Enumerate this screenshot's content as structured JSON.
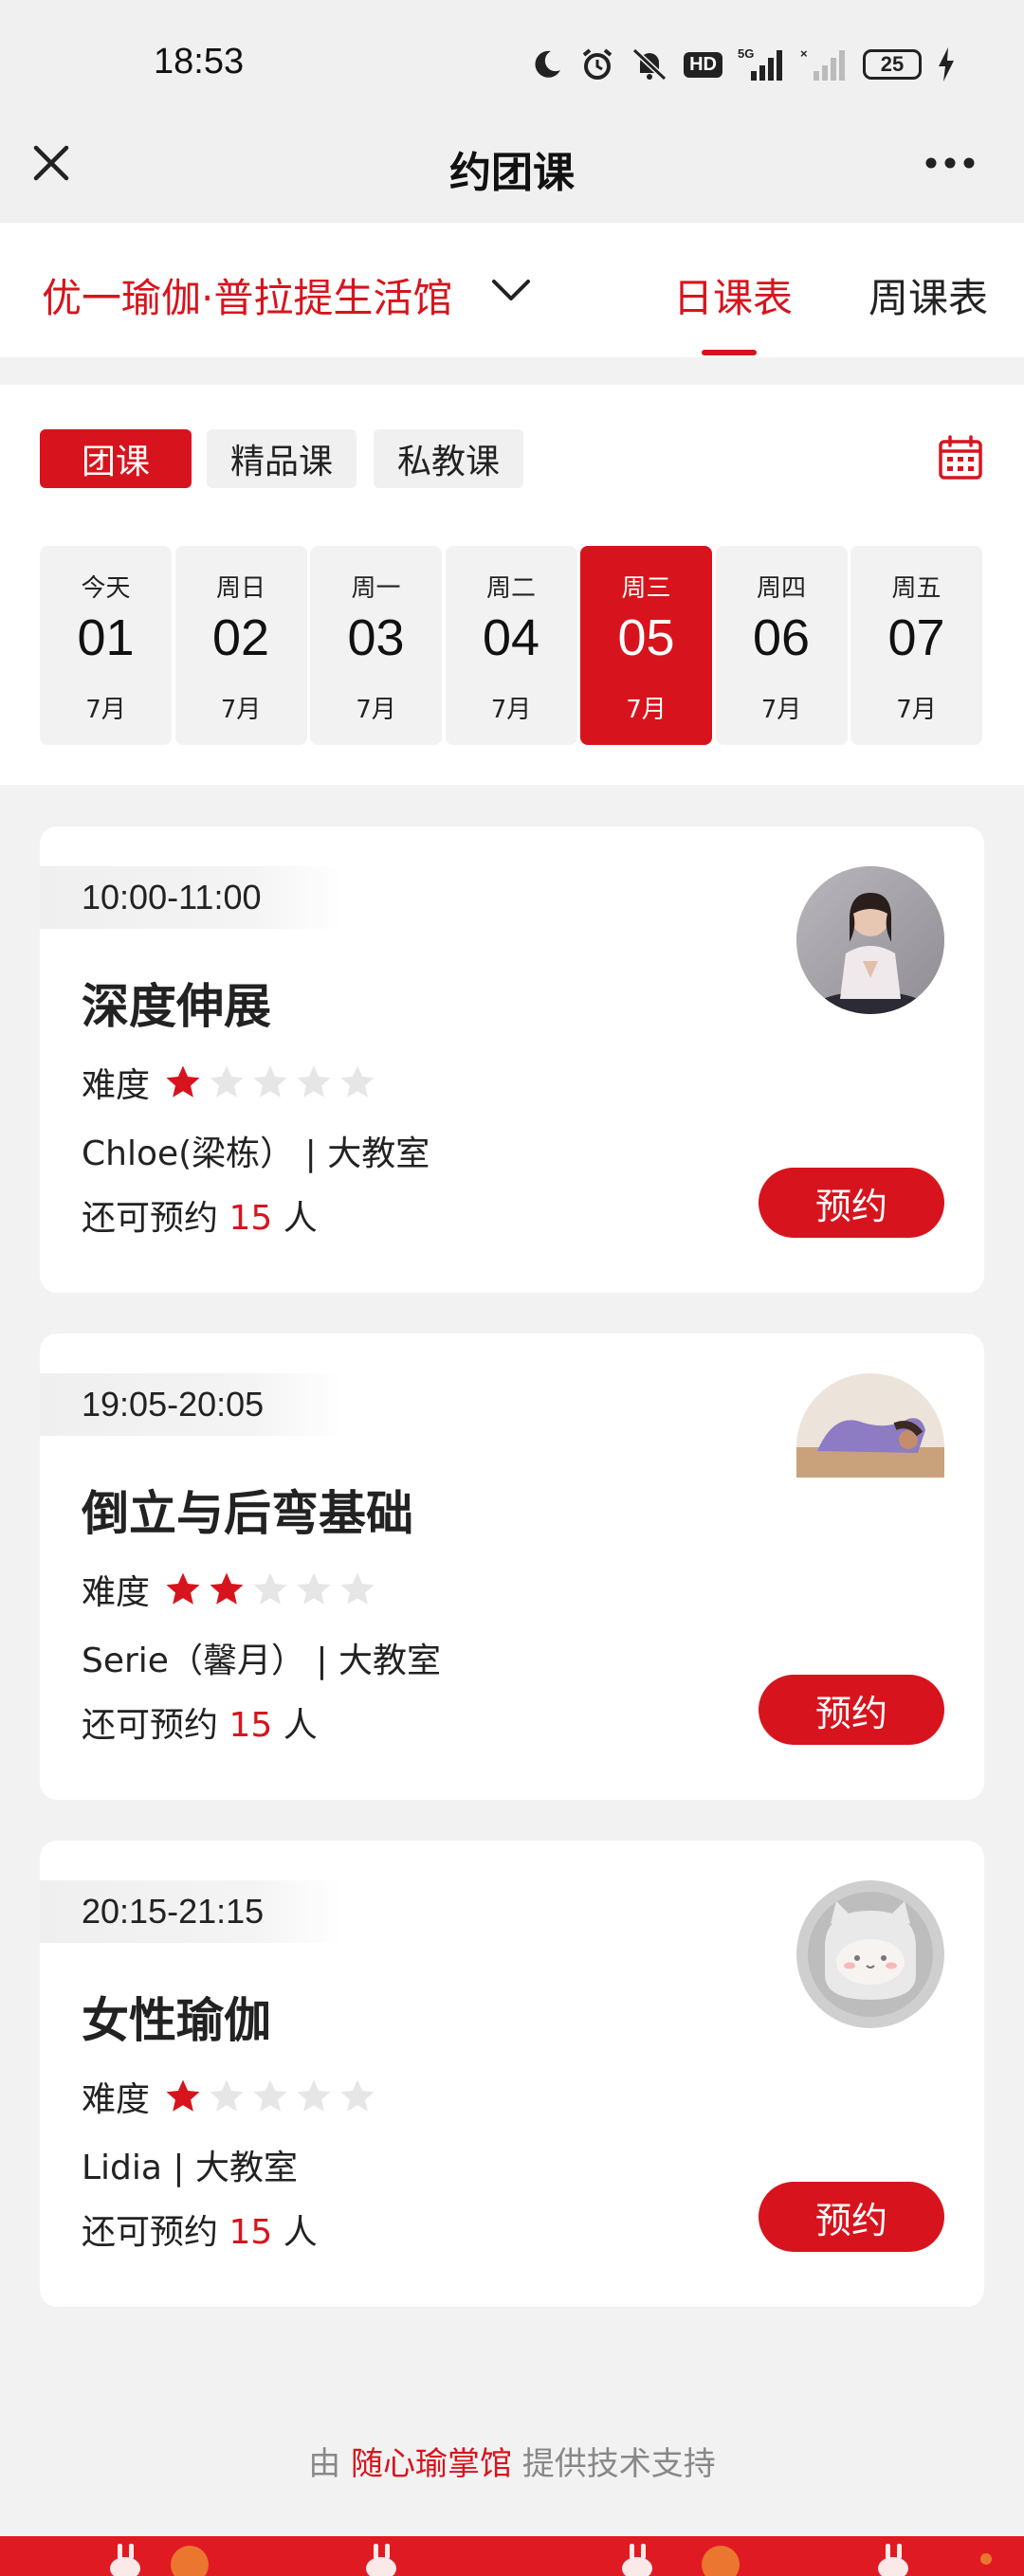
{
  "status_bar": {
    "time": "18:53",
    "battery": "25",
    "network": "5G",
    "hd": "HD"
  },
  "nav": {
    "title": "约团课"
  },
  "studio": {
    "name": "优一瑜伽·普拉提生活馆",
    "tabs": [
      "日课表",
      "周课表"
    ],
    "active_tab": "日课表"
  },
  "filters": {
    "chips": [
      "团课",
      "精品课",
      "私教课"
    ],
    "active": "团课"
  },
  "dates": [
    {
      "weekday": "今天",
      "day": "01",
      "month": "7月",
      "selected": false
    },
    {
      "weekday": "周日",
      "day": "02",
      "month": "7月",
      "selected": false
    },
    {
      "weekday": "周一",
      "day": "03",
      "month": "7月",
      "selected": false
    },
    {
      "weekday": "周二",
      "day": "04",
      "month": "7月",
      "selected": false
    },
    {
      "weekday": "周三",
      "day": "05",
      "month": "7月",
      "selected": true
    },
    {
      "weekday": "周四",
      "day": "06",
      "month": "7月",
      "selected": false
    },
    {
      "weekday": "周五",
      "day": "07",
      "month": "7月",
      "selected": false
    }
  ],
  "courses": [
    {
      "time": "10:00-11:00",
      "title": "深度伸展",
      "difficulty_label": "难度",
      "difficulty": 1,
      "teacher_room": "Chloe(梁栋） | 大教室",
      "remain_prefix": "还可预约",
      "remain_count": "15",
      "remain_suffix": "人",
      "book_label": "预约",
      "avatar": "yoga-instructor-photo"
    },
    {
      "time": "19:05-20:05",
      "title": "倒立与后弯基础",
      "difficulty_label": "难度",
      "difficulty": 2,
      "teacher_room": "Serie（馨月） | 大教室",
      "remain_prefix": "还可预约",
      "remain_count": "15",
      "remain_suffix": "人",
      "book_label": "预约",
      "avatar": "backbend-pose-photo"
    },
    {
      "time": "20:15-21:15",
      "title": "女性瑜伽",
      "difficulty_label": "难度",
      "difficulty": 1,
      "teacher_room": "Lidia | 大教室",
      "remain_prefix": "还可预约",
      "remain_count": "15",
      "remain_suffix": "人",
      "book_label": "预约",
      "avatar": "default-cat-avatar"
    }
  ],
  "footer": {
    "prefix": "由",
    "brand": "随心瑜掌馆",
    "suffix": "提供技术支持"
  },
  "colors": {
    "accent": "#d7141d",
    "page_bg": "#f2f2f2",
    "star_empty": "#e6e6e6"
  }
}
